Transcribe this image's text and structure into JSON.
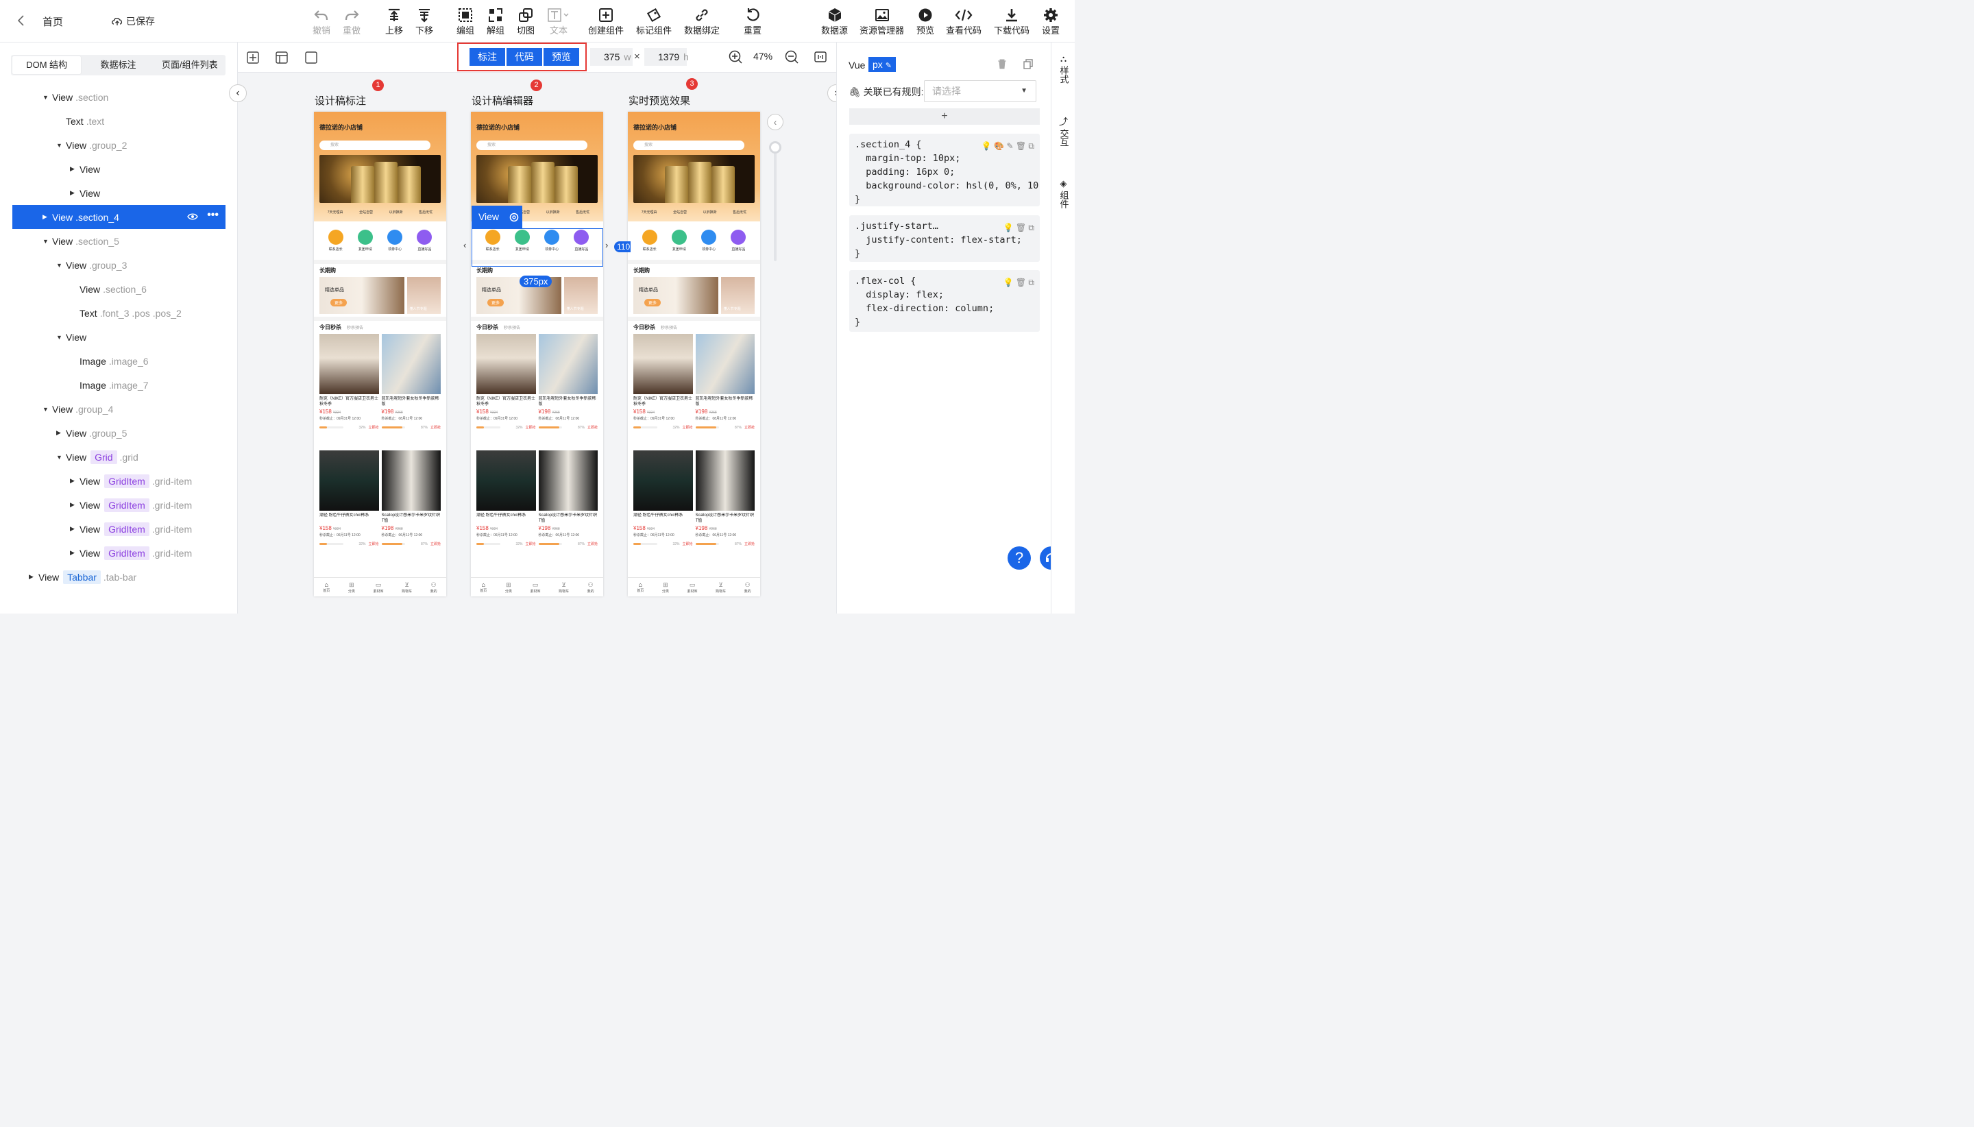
{
  "topbar": {
    "home": "首页",
    "saved": "已保存",
    "tools": [
      {
        "label": "撤销",
        "icon": "undo-icon",
        "disabled": true
      },
      {
        "label": "重做",
        "icon": "redo-icon",
        "disabled": true
      },
      {
        "label": "上移",
        "icon": "move-up-icon",
        "disabled": false
      },
      {
        "label": "下移",
        "icon": "move-down-icon",
        "disabled": false
      },
      {
        "label": "编组",
        "icon": "group-icon",
        "disabled": false
      },
      {
        "label": "解组",
        "icon": "ungroup-icon",
        "disabled": false
      },
      {
        "label": "切图",
        "icon": "slice-icon",
        "disabled": false
      },
      {
        "label": "文本",
        "icon": "text-icon",
        "disabled": true
      },
      {
        "label": "创建组件",
        "icon": "create-component-icon",
        "disabled": false
      },
      {
        "label": "标记组件",
        "icon": "tag-component-icon",
        "disabled": false
      },
      {
        "label": "数据绑定",
        "icon": "link-icon",
        "disabled": false
      },
      {
        "label": "重置",
        "icon": "reset-icon",
        "disabled": false
      },
      {
        "label": "数据源",
        "icon": "datasource-icon",
        "disabled": false
      },
      {
        "label": "资源管理器",
        "icon": "asset-manager-icon",
        "disabled": false
      },
      {
        "label": "预览",
        "icon": "preview-icon",
        "disabled": false
      },
      {
        "label": "查看代码",
        "icon": "code-icon",
        "disabled": false
      },
      {
        "label": "下载代码",
        "icon": "download-icon",
        "disabled": false
      },
      {
        "label": "设置",
        "icon": "gear-icon",
        "disabled": false
      }
    ]
  },
  "left": {
    "tabs": [
      "DOM 结构",
      "数据标注",
      "页面/组件列表"
    ],
    "tree": [
      {
        "indent": 2,
        "caret": "down",
        "name": "View",
        "cls": ".section"
      },
      {
        "indent": 3,
        "caret": "",
        "name": "Text",
        "cls": ".text"
      },
      {
        "indent": 3,
        "caret": "down",
        "name": "View",
        "cls": ".group_2"
      },
      {
        "indent": 4,
        "caret": "right",
        "name": "View",
        "cls": ""
      },
      {
        "indent": 4,
        "caret": "right",
        "name": "View",
        "cls": ""
      },
      {
        "indent": 2,
        "caret": "right",
        "name": "View",
        "cls": ".section_4",
        "selected": true
      },
      {
        "indent": 2,
        "caret": "down",
        "name": "View",
        "cls": ".section_5"
      },
      {
        "indent": 3,
        "caret": "down",
        "name": "View",
        "cls": ".group_3"
      },
      {
        "indent": 4,
        "caret": "",
        "name": "View",
        "cls": ".section_6"
      },
      {
        "indent": 4,
        "caret": "",
        "name": "Text",
        "cls": ".font_3 .pos .pos_2"
      },
      {
        "indent": 3,
        "caret": "down",
        "name": "View",
        "cls": ""
      },
      {
        "indent": 4,
        "caret": "",
        "name": "Image",
        "cls": ".image_6"
      },
      {
        "indent": 4,
        "caret": "",
        "name": "Image",
        "cls": ".image_7"
      },
      {
        "indent": 2,
        "caret": "down",
        "name": "View",
        "cls": ".group_4"
      },
      {
        "indent": 3,
        "caret": "right",
        "name": "View",
        "cls": ".group_5"
      },
      {
        "indent": 3,
        "caret": "down",
        "name": "View",
        "tag": "Grid",
        "cls": ".grid"
      },
      {
        "indent": 4,
        "caret": "right",
        "name": "View",
        "tag": "GridItem",
        "cls": ".grid-item"
      },
      {
        "indent": 4,
        "caret": "right",
        "name": "View",
        "tag": "GridItem",
        "cls": ".grid-item"
      },
      {
        "indent": 4,
        "caret": "right",
        "name": "View",
        "tag": "GridItem",
        "cls": ".grid-item"
      },
      {
        "indent": 4,
        "caret": "right",
        "name": "View",
        "tag": "GridItem",
        "cls": ".grid-item"
      },
      {
        "indent": 1,
        "caret": "right",
        "name": "View",
        "tagb": "Tabbar",
        "cls": ".tab-bar"
      }
    ]
  },
  "canvas": {
    "modes": [
      "标注",
      "代码",
      "预览"
    ],
    "width": "375",
    "width_unit": "w",
    "height": "1379",
    "height_unit": "h",
    "times": "×",
    "zoom": "47%",
    "columns": [
      {
        "badge": "1",
        "title": "设计稿标注"
      },
      {
        "badge": "2",
        "title": "设计稿编辑器"
      },
      {
        "badge": "3",
        "title": "实时预览效果"
      }
    ],
    "selection": {
      "label": "View",
      "width_label": "375px",
      "side_label": "110"
    }
  },
  "phone": {
    "shop": "德拉诺的小店铺",
    "search": "搜索",
    "tags": [
      "7天无理由",
      "全站自营",
      "以旧换新",
      "售后无忧"
    ],
    "icons": [
      {
        "label": "联系店长",
        "color": "#f5a623"
      },
      {
        "label": "复团申请",
        "color": "#3cc08a"
      },
      {
        "label": "领券中心",
        "color": "#2f8cf0"
      },
      {
        "label": "直播好品",
        "color": "#8e5cf0"
      }
    ],
    "long_title": "长期购",
    "long_card": "精选单品",
    "long_more": "更多",
    "long_side": "懂人节专题",
    "flash_title": "今日秒杀",
    "flash_sub": "秒杀预告",
    "products": [
      {
        "title": "耐克（NIKE）官方服店卫衣男士秋冬季",
        "price": "¥158",
        "orig": "¥324",
        "deadline": "秒杀截止：09月31号 12:00",
        "pct": "32%",
        "cta": "立即抢",
        "img": "linear-gradient(#cfc3b3, #e9dfd2 40%, #4a3426)"
      },
      {
        "title": "蓝玑毛呢短外套女秋冬季新款韩版",
        "price": "¥198",
        "orig": "¥268",
        "deadline": "秒杀截止：08月11号 12:00",
        "pct": "87%",
        "cta": "立即抢",
        "img": "linear-gradient(120deg, #a7c6df, #e8e3d9 50%, #6f8fb0)"
      },
      {
        "title": "潮径 粉色牛仔裤女chic韩系",
        "price": "¥158",
        "orig": "¥324",
        "deadline": "秒杀截止：06月11号 12:00",
        "pct": "32%",
        "cta": "立即抢",
        "img": "linear-gradient(#3c3c3c, #1b2f2b 50%, #111)"
      },
      {
        "title": "Scallop设计感米尔卡米罗纹针织T恤",
        "price": "¥198",
        "orig": "¥268",
        "deadline": "秒杀截止：06月11号 12:00",
        "pct": "87%",
        "cta": "立即抢",
        "img": "linear-gradient(90deg, #1a1a1a, #e8e4dc 50%, #141414)"
      }
    ],
    "tabbar": [
      "首页",
      "分类",
      "素材库",
      "购物车",
      "我的"
    ]
  },
  "right": {
    "framework": "Vue",
    "unit": "px",
    "rule_label": "关联已有规则:",
    "rule_placeholder": "请选择",
    "add": "+",
    "css1": ".section_4 {\n  margin-top: 10px;\n  padding: 16px 0;\n  background-color: hsl(0, 0%, 10\n}",
    "css2": ".justify-start…\n  justify-content: flex-start;\n}",
    "css3": ".flex-col {\n  display: flex;\n  flex-direction: column;\n}"
  },
  "rail": [
    "样式",
    "交互",
    "组件"
  ]
}
